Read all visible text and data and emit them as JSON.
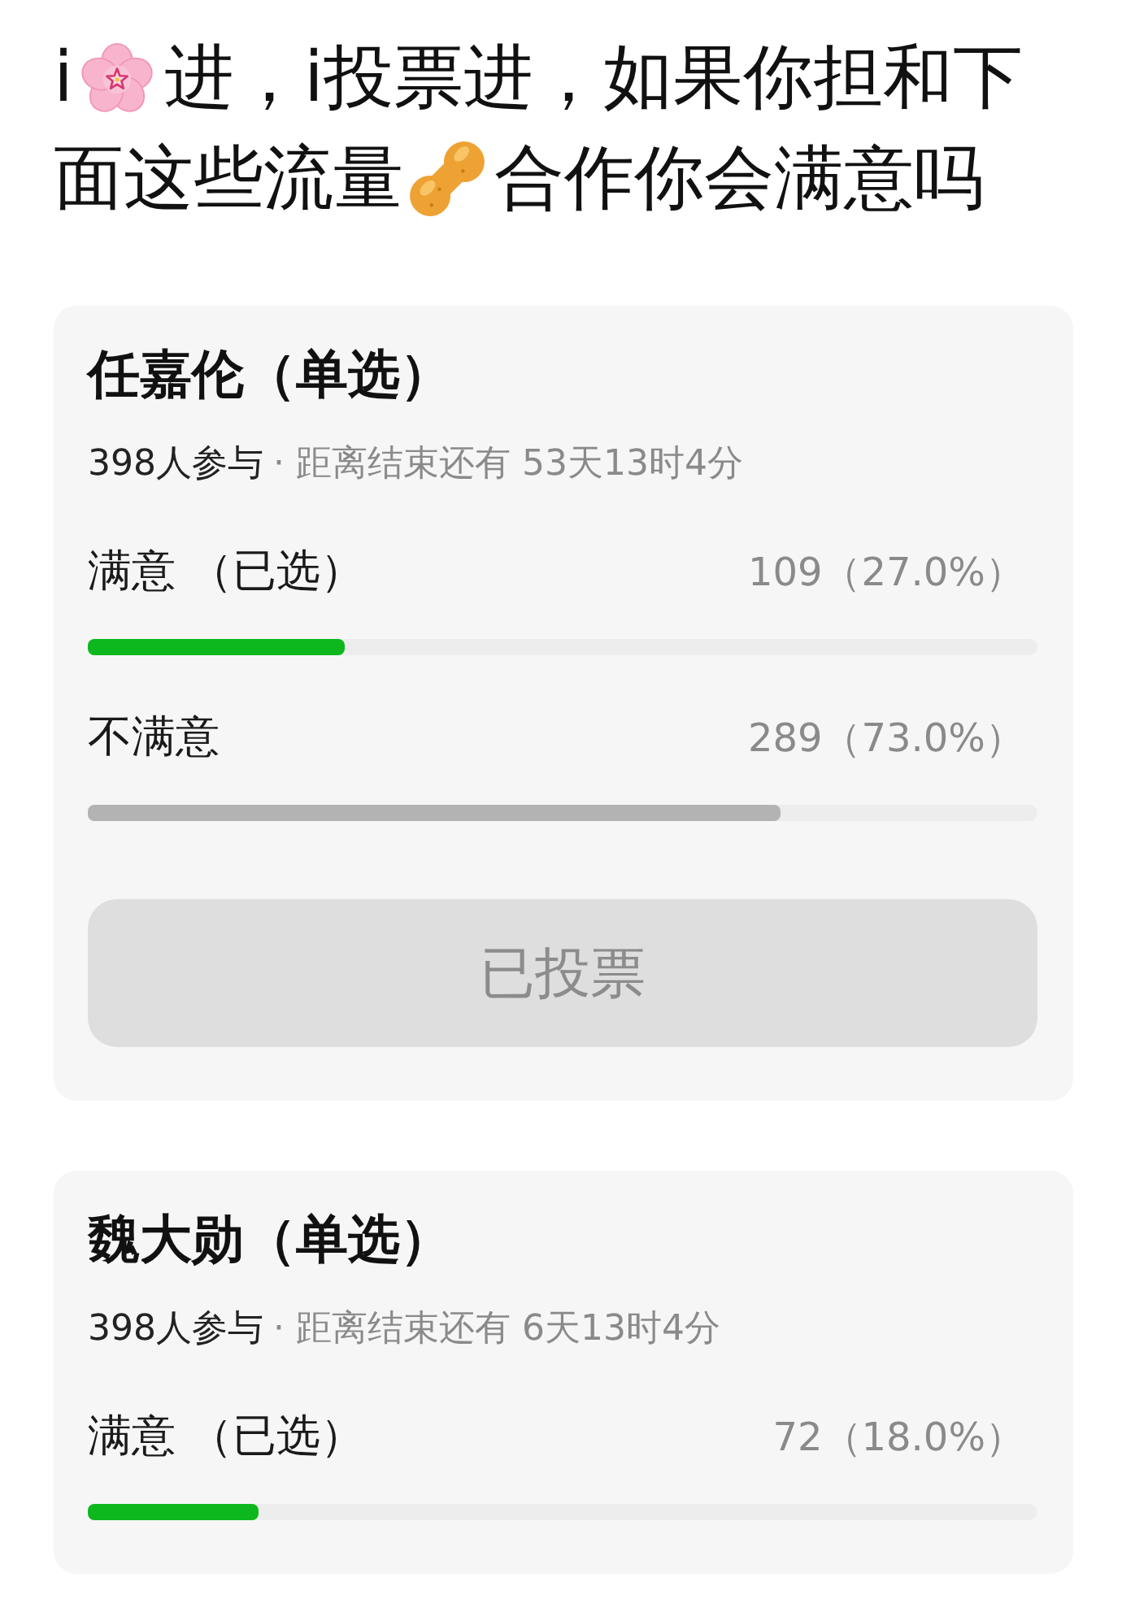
{
  "post": {
    "title_lines": [
      [
        "i",
        "进，i投票进，如果你担和下"
      ],
      [
        "面这些流量",
        "合作你会满意吗"
      ]
    ]
  },
  "polls": [
    {
      "title": "任嘉伦（单选）",
      "participants": "398人参与",
      "deadline": "· 距离结束还有 53天13时4分",
      "options": [
        {
          "label": "满意",
          "note": "（已选）",
          "selected": true,
          "count": "109（27.0%）",
          "level": 0.27
        },
        {
          "label": "不满意",
          "selected": false,
          "count": "289（73.0%）",
          "level": 0.73
        }
      ],
      "vote_button": {
        "label": "已投票",
        "disabled": true
      }
    },
    {
      "title": "魏大勋（单选）",
      "participants": "398人参与",
      "deadline": "· 距离结束还有 6天13时4分",
      "options": [
        {
          "label": "满意",
          "note": "（已选）",
          "selected": true,
          "count": "72（18.0%）",
          "level": 0.18
        }
      ]
    }
  ]
}
